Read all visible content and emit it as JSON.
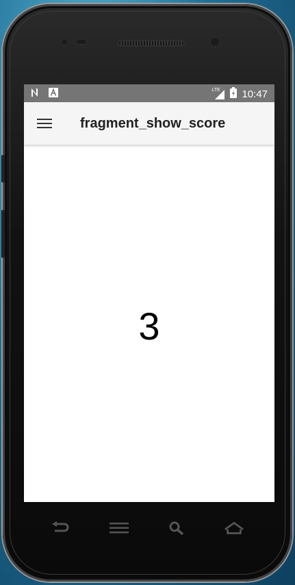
{
  "status_bar": {
    "time": "10:47",
    "network_label": "LTE",
    "left_icons": [
      "n-notification-icon",
      "a-notification-icon"
    ],
    "right_icons": [
      "signal-icon",
      "battery-charging-icon"
    ]
  },
  "app_bar": {
    "title": "fragment_show_score",
    "nav_icon": "hamburger-menu-icon"
  },
  "content": {
    "score": "3"
  },
  "nav_bar": {
    "icons": [
      "back-icon",
      "menu-icon",
      "search-icon",
      "home-icon"
    ]
  },
  "colors": {
    "status_bar_bg": "#757575",
    "app_bar_bg": "#f5f5f5",
    "content_bg": "#ffffff"
  }
}
